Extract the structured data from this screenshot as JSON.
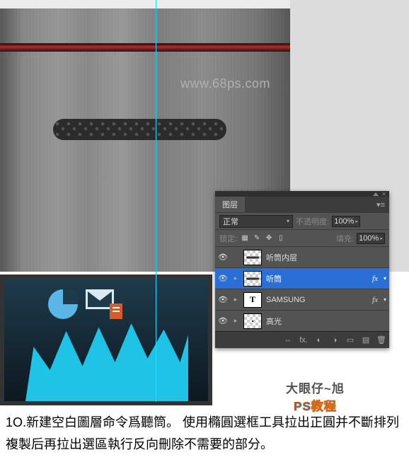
{
  "watermark": "www.68ps.com",
  "panel": {
    "tab_label": "图层",
    "blend_mode": "正常",
    "opacity_label": "不透明度:",
    "opacity_value": "100%",
    "lock_label": "锁定:",
    "fill_label": "填充:",
    "fill_value": "100%",
    "layers": {
      "inner": {
        "name": "听筒内层",
        "fx": ""
      },
      "earpiece": {
        "name": "听筒",
        "fx": "fx"
      },
      "samsung": {
        "name": "SAMSUNG",
        "fx": "fx"
      },
      "highlight": {
        "name": "高光",
        "fx": ""
      }
    },
    "footer_fx": "fx."
  },
  "brand": {
    "line1": "大眼仔~旭",
    "line2": "PS教程"
  },
  "step": {
    "number": "1O.",
    "body": "新建空白圖層命令爲聽筒。 使用橢圓選框工具拉出正圓并不斷排列複製后再拉出選區執行反向刪除不需要的部分。"
  }
}
